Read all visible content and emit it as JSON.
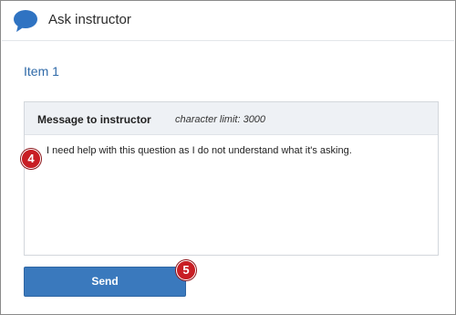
{
  "header": {
    "icon": "speech-bubble-icon",
    "title": "Ask instructor"
  },
  "item": {
    "title": "Item 1"
  },
  "message": {
    "label": "Message to instructor",
    "char_limit": "character limit: 3000",
    "value": "I need help with this question as I do not understand what it's asking."
  },
  "callouts": {
    "step4": "4",
    "step5": "5"
  },
  "actions": {
    "send_label": "Send"
  },
  "colors": {
    "accent": "#3a79bd",
    "item_title": "#2f6aa8",
    "callout": "#c81e24"
  }
}
